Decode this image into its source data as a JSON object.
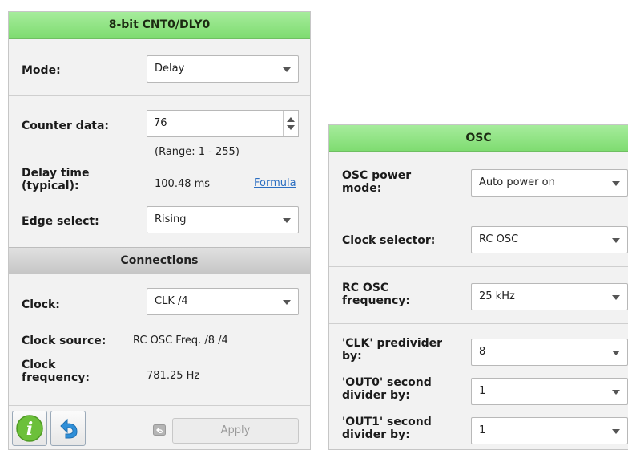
{
  "left_panel": {
    "title": "8-bit CNT0/DLY0",
    "mode": {
      "label": "Mode:",
      "value": "Delay"
    },
    "counter_data": {
      "label": "Counter data:",
      "value": "76",
      "range": "(Range:  1 - 255)"
    },
    "delay_time": {
      "label_line1": "Delay time",
      "label_line2": "(typical):",
      "value": "100.48 ms",
      "link": "Formula"
    },
    "edge_select": {
      "label": "Edge select:",
      "value": "Rising"
    },
    "connections_title": "Connections",
    "clock": {
      "label": "Clock:",
      "value": "CLK /4"
    },
    "clock_source": {
      "label": "Clock source:",
      "value": "RC OSC Freq. /8 /4"
    },
    "clock_frequency": {
      "label_line1": "Clock",
      "label_line2": "frequency:",
      "value": "781.25 Hz"
    },
    "apply_label": "Apply",
    "icons": {
      "info": "info-icon",
      "undo": "undo-icon",
      "revert": "revert-icon"
    },
    "accent": "#7fdc71"
  },
  "right_panel": {
    "title": "OSC",
    "power_mode": {
      "label_line1": "OSC power",
      "label_line2": "mode:",
      "value": "Auto power on"
    },
    "clock_selector": {
      "label": "Clock selector:",
      "value": "RC OSC"
    },
    "rc_osc_freq": {
      "label_line1": "RC OSC",
      "label_line2": "frequency:",
      "value": "25 kHz"
    },
    "clk_predivider": {
      "label_line1": "'CLK' predivider",
      "label_line2": "by:",
      "value": "8"
    },
    "out0_divider": {
      "label_line1": "'OUT0' second",
      "label_line2": "divider by:",
      "value": "1"
    },
    "out1_divider": {
      "label_line1": "'OUT1' second",
      "label_line2": "divider by:",
      "value": "1"
    }
  }
}
